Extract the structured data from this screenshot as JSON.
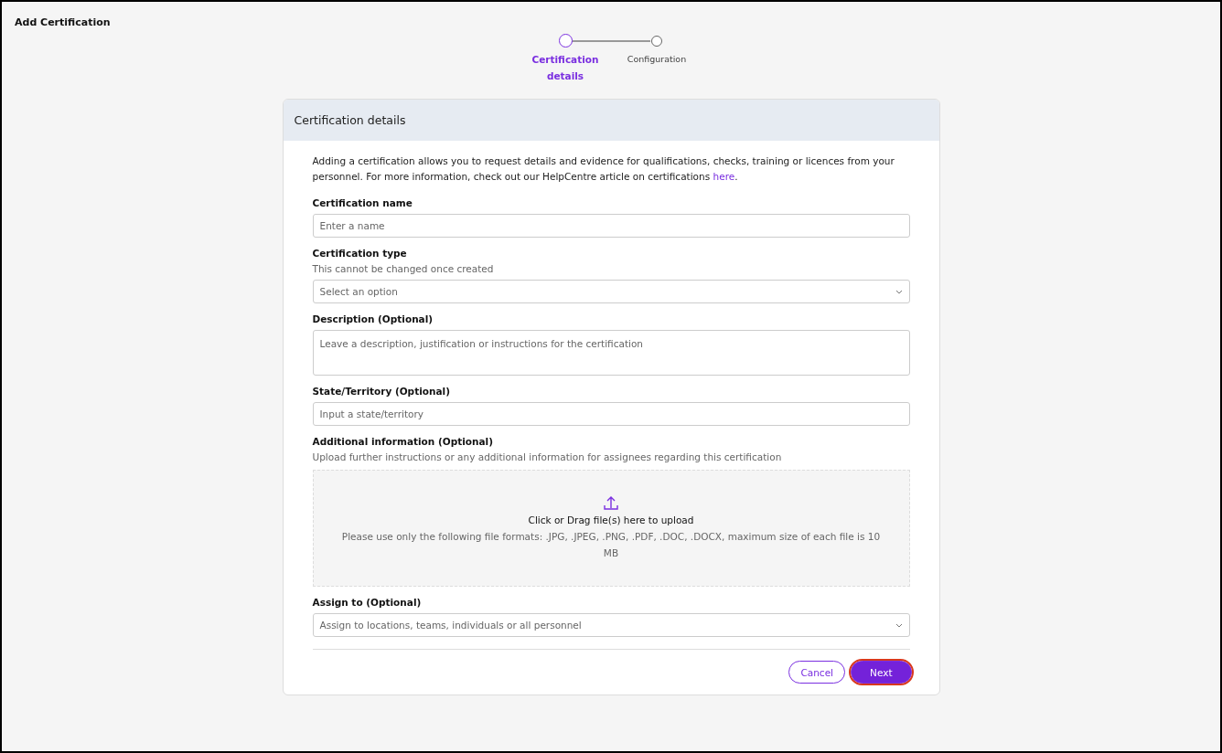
{
  "page_title": "Add Certification",
  "steps": [
    {
      "label": "Certification details",
      "selected": true
    },
    {
      "label": "Configuration",
      "selected": false
    }
  ],
  "card": {
    "title": "Certification details",
    "intro": "Adding a certification allows you to request details and evidence for qualifications, checks, training or licences from your personnel. For more information, check out our HelpCentre article on certifications ",
    "intro_link": "here",
    "intro_end": ".",
    "fields": [
      {
        "kind": "text",
        "label": "Certification name",
        "placeholder": "Enter a name"
      },
      {
        "kind": "select",
        "label": "Certification type",
        "hint": "This cannot be changed once created",
        "placeholder": "Select an option"
      },
      {
        "kind": "textarea",
        "label": "Description (Optional)",
        "placeholder": "Leave a description, justification or instructions for the certification"
      },
      {
        "kind": "text",
        "label": "State/Territory (Optional)",
        "placeholder": "Input a state/territory"
      },
      {
        "kind": "upload",
        "label": "Additional information (Optional)",
        "hint": "Upload further instructions or any additional information for assignees regarding this certification",
        "upload_title": "Click or Drag file(s) here to upload",
        "upload_note": "Please use only the following file formats: .JPG, .JPEG, .PNG, .PDF, .DOC, .DOCX, maximum size of each file is 10 MB"
      },
      {
        "kind": "select",
        "label": "Assign to (Optional)",
        "placeholder": "Assign to locations, teams, individuals or all personnel"
      }
    ],
    "buttons": [
      {
        "kind": "secondary",
        "label": "Cancel",
        "focused": false
      },
      {
        "kind": "primary",
        "label": "Next",
        "focused": true
      }
    ]
  }
}
